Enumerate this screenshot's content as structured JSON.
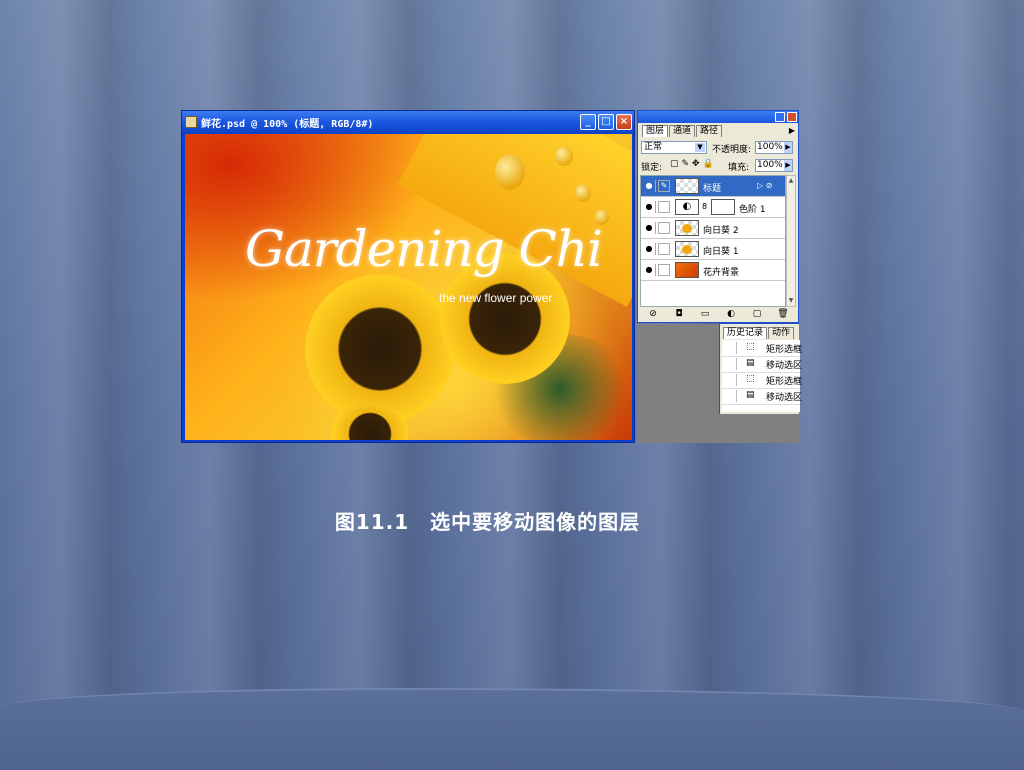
{
  "slide": {
    "caption": "图11.1　选中要移动图像的图层"
  },
  "document_window": {
    "title": "鲜花.psd @ 100% (标题, RGB/8#)",
    "buttons": {
      "minimize": "_",
      "maximize": "□",
      "close": "×"
    },
    "artwork": {
      "script_title": "Gardening Chi",
      "tagline": "the new flower power"
    }
  },
  "layers_panel": {
    "tabs": [
      "图层",
      "通道",
      "路径"
    ],
    "blend_mode": "正常",
    "opacity_label": "不透明度:",
    "opacity_value": "100%",
    "lock_label": "锁定:",
    "fill_label": "填充:",
    "fill_value": "100%",
    "layers": [
      {
        "name": "标题",
        "selected": true,
        "type": "text"
      },
      {
        "name": "色阶 1",
        "selected": false,
        "type": "adjustment"
      },
      {
        "name": "向日葵 2",
        "selected": false,
        "type": "image"
      },
      {
        "name": "向日葵 1",
        "selected": false,
        "type": "image"
      },
      {
        "name": "花卉背景",
        "selected": false,
        "type": "background"
      }
    ]
  },
  "history_panel": {
    "tabs": [
      "历史记录",
      "动作"
    ],
    "items": [
      "矩形选框",
      "移动选区",
      "矩形选框",
      "移动选区"
    ]
  },
  "colors": {
    "title_bar_blue": "#1a56df",
    "selected_layer": "#316ac5",
    "panel_bg": "#ece9d8",
    "slide_bg": "#6e84ab"
  }
}
